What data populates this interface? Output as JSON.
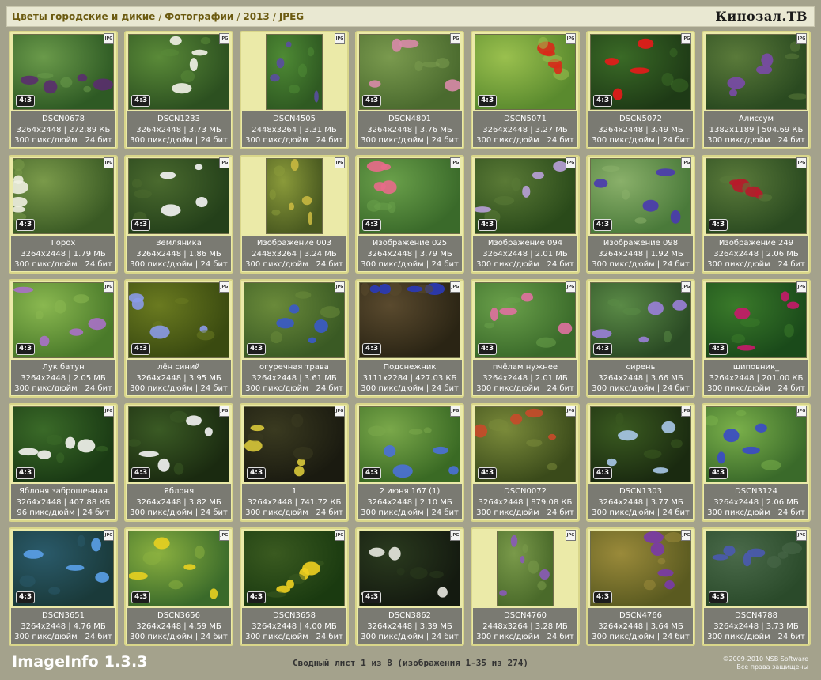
{
  "breadcrumb": [
    "Цветы городские и дикие",
    "Фотографии",
    "2013",
    "JPEG"
  ],
  "brand": "Кинозал.ТВ",
  "app_name": "ImageInfo 1.3.3",
  "summary": "Сводный лист 1 из 8 (изображения 1-35 из 274)",
  "copyright": [
    "©2009-2010 NSB Software",
    "Все права защищены"
  ],
  "format_badge": "JPG",
  "tiles": [
    {
      "name": "DSCN0678",
      "dims": "3264x2448",
      "size": "272.89 КБ",
      "meta": "300 пикс/дюйм | 24 бит",
      "ratio": "4:3",
      "orient": "land",
      "colors": [
        "#2e5a24",
        "#6a9a4a",
        "#5a2e6e"
      ]
    },
    {
      "name": "DSCN1233",
      "dims": "3264x2448",
      "size": "3.73 МБ",
      "meta": "300 пикс/дюйм | 24 бит",
      "ratio": "4:3",
      "orient": "land",
      "colors": [
        "#2c5020",
        "#5a8a38",
        "#f2f2e8"
      ]
    },
    {
      "name": "DSCN4505",
      "dims": "2448x3264",
      "size": "3.31 МБ",
      "meta": "300 пикс/дюйм | 24 бит",
      "ratio": "",
      "orient": "port",
      "colors": [
        "#2f5a22",
        "#4e8a34",
        "#5a4ea0"
      ]
    },
    {
      "name": "DSCN4801",
      "dims": "3264x2448",
      "size": "3.76 МБ",
      "meta": "300 пикс/дюйм | 24 бит",
      "ratio": "4:3",
      "orient": "land",
      "colors": [
        "#4a6a2e",
        "#7a9a4e",
        "#d88aa8"
      ]
    },
    {
      "name": "DSCN5071",
      "dims": "3264x2448",
      "size": "3.27 МБ",
      "meta": "300 пикс/дюйм | 24 бит",
      "ratio": "4:3",
      "orient": "land",
      "colors": [
        "#5a8a2e",
        "#9ac04e",
        "#d82a1a"
      ]
    },
    {
      "name": "DSCN5072",
      "dims": "3264x2448",
      "size": "3.49 МБ",
      "meta": "300 пикс/дюйм | 24 бит",
      "ratio": "4:3",
      "orient": "land",
      "colors": [
        "#1e3a16",
        "#3a6a26",
        "#e81a1a"
      ]
    },
    {
      "name": "Алиссум",
      "dims": "1382x1189",
      "size": "504.69 КБ",
      "meta": "300 пикс/дюйм | 24 бит",
      "ratio": "",
      "orient": "land",
      "colors": [
        "#2a4a20",
        "#5a7a3a",
        "#7a4aa8"
      ]
    },
    {
      "name": "Горох",
      "dims": "3264x2448",
      "size": "1.79 МБ",
      "meta": "300 пикс/дюйм | 24 бит",
      "ratio": "4:3",
      "orient": "land",
      "colors": [
        "#3a5a24",
        "#7a9a4a",
        "#f0f0e0"
      ]
    },
    {
      "name": "Земляника",
      "dims": "3264x2448",
      "size": "1.86 МБ",
      "meta": "300 пикс/дюйм | 24 бит",
      "ratio": "4:3",
      "orient": "land",
      "colors": [
        "#24401a",
        "#4a6a2e",
        "#f4f4f4"
      ]
    },
    {
      "name": "Изображение 003",
      "dims": "2448x3264",
      "size": "3.24 МБ",
      "meta": "300 пикс/дюйм | 24 бит",
      "ratio": "",
      "orient": "port",
      "colors": [
        "#4a5a20",
        "#8a9a3a",
        "#c8b840"
      ]
    },
    {
      "name": "Изображение 025",
      "dims": "3264x2448",
      "size": "3.79 МБ",
      "meta": "300 пикс/дюйм | 24 бит",
      "ratio": "4:3",
      "orient": "land",
      "colors": [
        "#3a6a2a",
        "#6aa04a",
        "#e86a8a"
      ]
    },
    {
      "name": "Изображение 094",
      "dims": "3264x2448",
      "size": "2.01 МБ",
      "meta": "300 пикс/дюйм | 24 бит",
      "ratio": "4:3",
      "orient": "land",
      "colors": [
        "#2a4a1a",
        "#5a7a36",
        "#b8a0d8"
      ]
    },
    {
      "name": "Изображение 098",
      "dims": "3264x2448",
      "size": "1.92 МБ",
      "meta": "300 пикс/дюйм | 24 бит",
      "ratio": "4:3",
      "orient": "land",
      "colors": [
        "#4a7a3a",
        "#8ab06a",
        "#4a3ab0"
      ]
    },
    {
      "name": "Изображение 249",
      "dims": "3264x2448",
      "size": "2.06 МБ",
      "meta": "300 пикс/дюйм | 24 бит",
      "ratio": "4:3",
      "orient": "land",
      "colors": [
        "#2a4a20",
        "#5a7a3a",
        "#b81a2a"
      ]
    },
    {
      "name": "Лук батун",
      "dims": "3264x2448",
      "size": "2.05 МБ",
      "meta": "300 пикс/дюйм | 24 бит",
      "ratio": "4:3",
      "orient": "land",
      "colors": [
        "#4a7a2a",
        "#8ab850",
        "#a870c8"
      ]
    },
    {
      "name": "лён синий",
      "dims": "3264x2448",
      "size": "3.95 МБ",
      "meta": "300 пикс/дюйм | 24 бит",
      "ratio": "4:3",
      "orient": "land",
      "colors": [
        "#3a4a10",
        "#6a7a20",
        "#8a9ae8"
      ]
    },
    {
      "name": "огуречная трава",
      "dims": "3264x2448",
      "size": "3.61 МБ",
      "meta": "300 пикс/дюйм | 24 бит",
      "ratio": "4:3",
      "orient": "land",
      "colors": [
        "#3a5a24",
        "#6a8a3a",
        "#3a5ac8"
      ]
    },
    {
      "name": "Подснежник",
      "dims": "3111x2284",
      "size": "427.03 КБ",
      "meta": "300 пикс/дюйм | 24 бит",
      "ratio": "4:3",
      "orient": "land",
      "colors": [
        "#2a2414",
        "#5a4a2e",
        "#2a3ab8"
      ]
    },
    {
      "name": "пчёлам нужнее",
      "dims": "3264x2448",
      "size": "2.01 МБ",
      "meta": "300 пикс/дюйм | 24 бит",
      "ratio": "4:3",
      "orient": "land",
      "colors": [
        "#3a6a2a",
        "#6aa04a",
        "#e070a0"
      ]
    },
    {
      "name": "сирень",
      "dims": "3264x2448",
      "size": "3.66 МБ",
      "meta": "300 пикс/дюйм | 24 бит",
      "ratio": "4:3",
      "orient": "land",
      "colors": [
        "#2a4a24",
        "#5a8a46",
        "#9a80d8"
      ]
    },
    {
      "name": "шиповник_",
      "dims": "3264x2448",
      "size": "201.00 КБ",
      "meta": "300 пикс/дюйм | 24 бит",
      "ratio": "4:3",
      "orient": "land",
      "colors": [
        "#1a4a1a",
        "#3a7a2a",
        "#c81a6a"
      ]
    },
    {
      "name": "Яблоня заброшенная",
      "dims": "3264x2448",
      "size": "407.88 КБ",
      "meta": "96 пикс/дюйм | 24 бит",
      "ratio": "4:3",
      "orient": "land",
      "colors": [
        "#1a3a14",
        "#3a6a28",
        "#f4f4f0"
      ]
    },
    {
      "name": "Яблоня",
      "dims": "3264x2448",
      "size": "3.82 МБ",
      "meta": "300 пикс/дюйм | 24 бит",
      "ratio": "4:3",
      "orient": "land",
      "colors": [
        "#1a2a10",
        "#3a5a24",
        "#f4f4f4"
      ]
    },
    {
      "name": "1",
      "dims": "3264x2448",
      "size": "741.72 КБ",
      "meta": "300 пикс/дюйм | 24 бит",
      "ratio": "4:3",
      "orient": "land",
      "colors": [
        "#1a1a10",
        "#3a3a20",
        "#d8c83a"
      ]
    },
    {
      "name": "2 июня 167 (1)",
      "dims": "3264x2448",
      "size": "2.10 МБ",
      "meta": "300 пикс/дюйм | 24 бит",
      "ratio": "4:3",
      "orient": "land",
      "colors": [
        "#3a6a24",
        "#7aa84a",
        "#4a70d8"
      ]
    },
    {
      "name": "DSCN0072",
      "dims": "3264x2448",
      "size": "879.08 КБ",
      "meta": "300 пикс/дюйм | 24 бит",
      "ratio": "4:3",
      "orient": "land",
      "colors": [
        "#3a4a1a",
        "#7a8a3a",
        "#c84a2a"
      ]
    },
    {
      "name": "DSCN1303",
      "dims": "3264x2448",
      "size": "3.77 МБ",
      "meta": "300 пикс/дюйм | 24 бит",
      "ratio": "4:3",
      "orient": "land",
      "colors": [
        "#1a2a10",
        "#3a5a20",
        "#a8c8e8"
      ]
    },
    {
      "name": "DSCN3124",
      "dims": "3264x2448",
      "size": "2.06 МБ",
      "meta": "300 пикс/дюйм | 24 бит",
      "ratio": "4:3",
      "orient": "land",
      "colors": [
        "#3a6a2a",
        "#7ab04a",
        "#3a4ac8"
      ]
    },
    {
      "name": "DSCN3651",
      "dims": "3264x2448",
      "size": "4.76 МБ",
      "meta": "300 пикс/дюйм | 24 бит",
      "ratio": "4:3",
      "orient": "land",
      "colors": [
        "#1a3a3a",
        "#2a5a6a",
        "#5aa0e8"
      ]
    },
    {
      "name": "DSCN3656",
      "dims": "3264x2448",
      "size": "4.59 МБ",
      "meta": "300 пикс/дюйм | 24 бит",
      "ratio": "4:3",
      "orient": "land",
      "colors": [
        "#3a6a2a",
        "#8ab040",
        "#e8d020"
      ]
    },
    {
      "name": "DSCN3658",
      "dims": "3264x2448",
      "size": "4.00 МБ",
      "meta": "300 пикс/дюйм | 24 бит",
      "ratio": "4:3",
      "orient": "land",
      "colors": [
        "#1a3a10",
        "#3a5a20",
        "#f0d020"
      ]
    },
    {
      "name": "DSCN3862",
      "dims": "3264x2448",
      "size": "3.39 МБ",
      "meta": "300 пикс/дюйм | 24 бит",
      "ratio": "4:3",
      "orient": "land",
      "colors": [
        "#141a10",
        "#2a3a1e",
        "#e8e8e0"
      ]
    },
    {
      "name": "DSCN4760",
      "dims": "2448x3264",
      "size": "3.28 МБ",
      "meta": "300 пикс/дюйм | 24 бит",
      "ratio": "",
      "orient": "port",
      "colors": [
        "#4a6a2a",
        "#7a9a4a",
        "#8a5ab8"
      ]
    },
    {
      "name": "DSCN4766",
      "dims": "3264x2448",
      "size": "3.64 МБ",
      "meta": "300 пикс/дюйм | 24 бит",
      "ratio": "4:3",
      "orient": "land",
      "colors": [
        "#5a5a20",
        "#9a8a3a",
        "#7a3aa8"
      ]
    },
    {
      "name": "DSCN4788",
      "dims": "3264x2448",
      "size": "3.73 МБ",
      "meta": "300 пикс/дюйм | 24 бит",
      "ratio": "4:3",
      "orient": "land",
      "colors": [
        "#2a4a2a",
        "#4a6a4a",
        "#4a5ab0"
      ]
    }
  ]
}
